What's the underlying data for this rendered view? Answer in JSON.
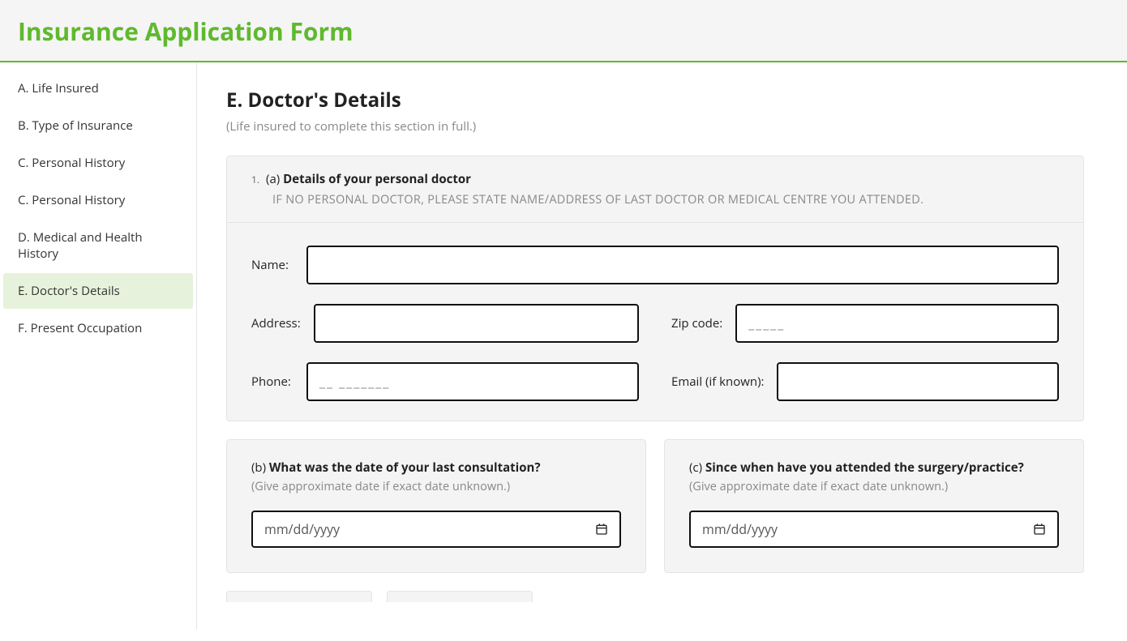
{
  "header": {
    "title": "Insurance Application Form"
  },
  "sidebar": {
    "items": [
      {
        "label": "A. Life Insured",
        "active": false
      },
      {
        "label": "B. Type of Insurance",
        "active": false
      },
      {
        "label": "C. Personal History",
        "active": false
      },
      {
        "label": "C. Personal History",
        "active": false
      },
      {
        "label": "D. Medical and Health History",
        "active": false
      },
      {
        "label": "E. Doctor's Details",
        "active": true
      },
      {
        "label": "F. Present Occupation",
        "active": false
      }
    ]
  },
  "section": {
    "title": "E. Doctor's Details",
    "subtitle": "(Life insured to complete this section in full.)"
  },
  "q1": {
    "number": "1.",
    "part_a": "(a) ",
    "part_b": "Details of your personal doctor",
    "hint": "IF NO PERSONAL DOCTOR, PLEASE STATE NAME/ADDRESS OF LAST DOCTOR OR MEDICAL CENTRE YOU ATTENDED.",
    "fields": {
      "name_label": "Name:",
      "address_label": "Address:",
      "zip_label": "Zip code:",
      "zip_placeholder": "_____",
      "phone_label": "Phone:",
      "phone_placeholder": "__ _______",
      "email_label": "Email (if known):"
    }
  },
  "q_b": {
    "part_a": "(b) ",
    "part_b": "What was the date of your last consultation?",
    "hint": "(Give approximate date if exact date unknown.)",
    "placeholder": "mm/dd/yyyy"
  },
  "q_c": {
    "part_a": "(c) ",
    "part_b": "Since when have you attended the surgery/practice?",
    "hint": "(Give approximate date if exact date unknown.)",
    "placeholder": "mm/dd/yyyy"
  }
}
